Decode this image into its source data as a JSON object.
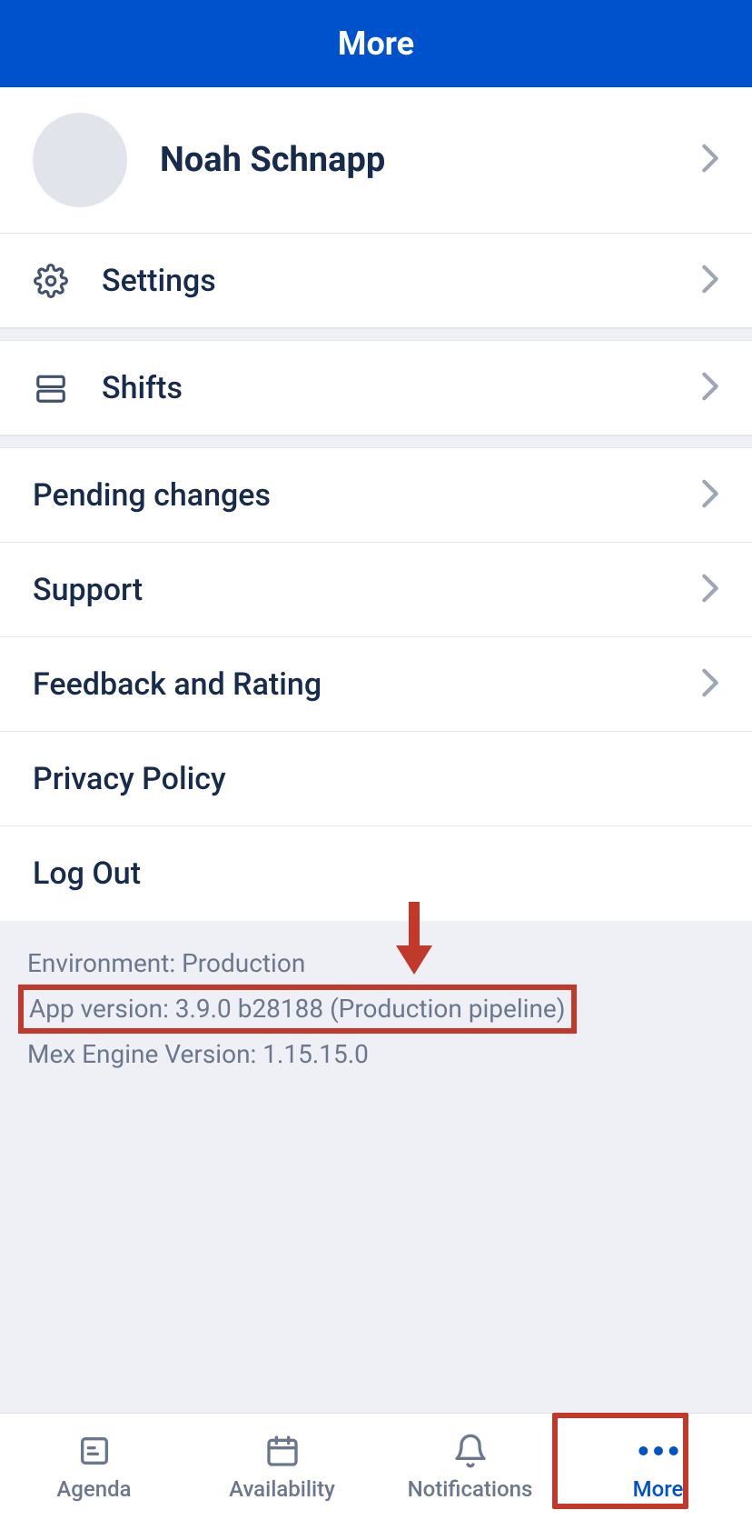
{
  "header": {
    "title": "More"
  },
  "profile": {
    "name": "Noah Schnapp"
  },
  "menu": {
    "settings": "Settings",
    "shifts": "Shifts",
    "pending_changes": "Pending changes",
    "support": "Support",
    "feedback": "Feedback and Rating",
    "privacy": "Privacy Policy",
    "logout": "Log Out"
  },
  "footer": {
    "environment": "Environment: Production",
    "app_version": "App version: 3.9.0 b28188 (Production pipeline)",
    "mex_engine": "Mex Engine Version: 1.15.15.0"
  },
  "tabs": {
    "agenda": "Agenda",
    "availability": "Availability",
    "notifications": "Notifications",
    "more": "More"
  },
  "colors": {
    "brand": "#0052cc",
    "annotation": "#c0392b",
    "text_primary": "#172b4d",
    "text_muted": "#6b778c"
  }
}
